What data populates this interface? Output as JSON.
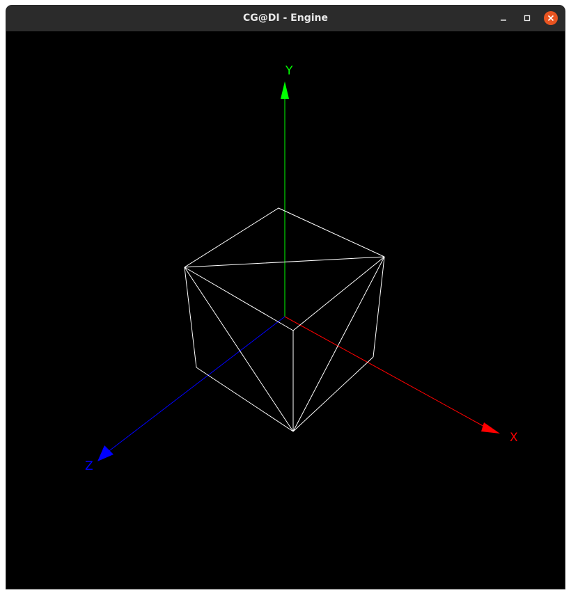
{
  "window": {
    "title": "CG@DI - Engine"
  },
  "controls": {
    "minimize_icon": "minimize-icon",
    "maximize_icon": "maximize-icon",
    "close_icon": "close-icon",
    "close_color": "#e95420"
  },
  "scene": {
    "background": "#000000",
    "axes": {
      "x": {
        "label": "X",
        "color": "#ff0000"
      },
      "y": {
        "label": "Y",
        "color": "#00ff00"
      },
      "z": {
        "label": "Z",
        "color": "#0000ff"
      }
    },
    "model_color": "#ffffff"
  }
}
